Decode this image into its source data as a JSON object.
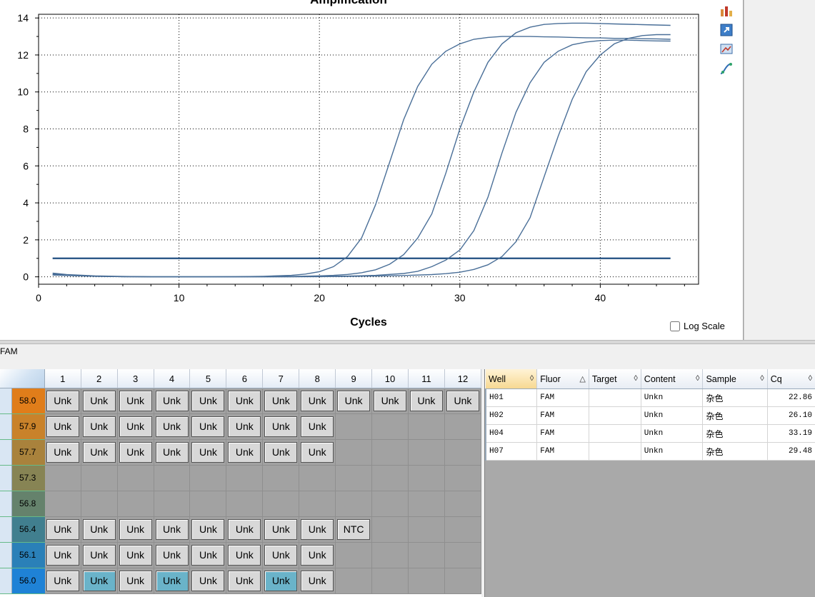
{
  "chart_data": {
    "type": "line",
    "title": "Amplification",
    "xlabel": "Cycles",
    "ylabel": "",
    "xlim": [
      0,
      47
    ],
    "ylim": [
      -0.4,
      14.2
    ],
    "xticks": [
      0,
      10,
      20,
      30,
      40
    ],
    "yticks": [
      0,
      2,
      4,
      6,
      8,
      10,
      12,
      14
    ],
    "grid": true,
    "threshold": 1.0,
    "series": [
      {
        "x": [
          1,
          2,
          4,
          6,
          8,
          10,
          12,
          14,
          16,
          18,
          19,
          20,
          21,
          22,
          23,
          24,
          25,
          26,
          27,
          28,
          29,
          30,
          31,
          32,
          33,
          34,
          35,
          36,
          37,
          38,
          39,
          40,
          41,
          42,
          43,
          44,
          45
        ],
        "y": [
          0.2,
          0.12,
          0.05,
          0.02,
          0.0,
          0.0,
          0.0,
          0.01,
          0.03,
          0.08,
          0.15,
          0.28,
          0.55,
          1.1,
          2.1,
          3.9,
          6.2,
          8.5,
          10.3,
          11.5,
          12.2,
          12.6,
          12.85,
          12.95,
          13.0,
          13.0,
          13.0,
          12.98,
          12.97,
          12.95,
          12.93,
          12.92,
          12.9,
          12.9,
          12.88,
          12.87,
          12.85
        ]
      },
      {
        "x": [
          1,
          2,
          4,
          6,
          8,
          10,
          12,
          14,
          16,
          18,
          20,
          21,
          22,
          23,
          24,
          25,
          26,
          27,
          28,
          29,
          30,
          31,
          32,
          33,
          34,
          35,
          36,
          37,
          38,
          39,
          40,
          41,
          42,
          43,
          44,
          45
        ],
        "y": [
          0.15,
          0.1,
          0.04,
          0.01,
          0.0,
          0.0,
          0.0,
          0.0,
          0.01,
          0.02,
          0.05,
          0.08,
          0.13,
          0.22,
          0.38,
          0.68,
          1.2,
          2.1,
          3.4,
          5.6,
          8.0,
          10.0,
          11.6,
          12.6,
          13.2,
          13.5,
          13.65,
          13.7,
          13.72,
          13.72,
          13.7,
          13.68,
          13.66,
          13.64,
          13.62,
          13.6
        ]
      },
      {
        "x": [
          1,
          2,
          4,
          6,
          8,
          10,
          12,
          14,
          16,
          18,
          20,
          22,
          24,
          26,
          27,
          28,
          29,
          30,
          31,
          32,
          33,
          34,
          35,
          36,
          37,
          38,
          39,
          40,
          41,
          42,
          43,
          44,
          45
        ],
        "y": [
          0.1,
          0.08,
          0.03,
          0.01,
          0.0,
          0.0,
          0.0,
          0.0,
          0.0,
          0.01,
          0.02,
          0.04,
          0.08,
          0.18,
          0.3,
          0.55,
          0.9,
          1.45,
          2.5,
          4.3,
          6.7,
          8.9,
          10.5,
          11.6,
          12.2,
          12.55,
          12.7,
          12.78,
          12.8,
          12.8,
          12.78,
          12.76,
          12.75
        ]
      },
      {
        "x": [
          1,
          2,
          4,
          6,
          8,
          10,
          12,
          14,
          16,
          18,
          20,
          22,
          24,
          26,
          28,
          29,
          30,
          31,
          32,
          33,
          34,
          35,
          36,
          37,
          38,
          39,
          40,
          41,
          42,
          43,
          44,
          45
        ],
        "y": [
          0.1,
          0.07,
          0.03,
          0.01,
          0.0,
          0.0,
          0.0,
          0.0,
          0.0,
          0.0,
          0.01,
          0.02,
          0.04,
          0.07,
          0.12,
          0.17,
          0.25,
          0.4,
          0.65,
          1.1,
          1.9,
          3.2,
          5.4,
          7.6,
          9.6,
          11.1,
          12.0,
          12.6,
          12.9,
          13.05,
          13.1,
          13.1
        ]
      }
    ]
  },
  "log_scale_label": "Log Scale",
  "fluor_tab": "FAM",
  "plate": {
    "columns": [
      "1",
      "2",
      "3",
      "4",
      "5",
      "6",
      "7",
      "8",
      "9",
      "10",
      "11",
      "12"
    ],
    "rows": [
      {
        "temp": "58.0",
        "color": "#e07d1a",
        "cells": [
          "Unk",
          "Unk",
          "Unk",
          "Unk",
          "Unk",
          "Unk",
          "Unk",
          "Unk",
          "Unk",
          "Unk",
          "Unk",
          "Unk"
        ]
      },
      {
        "temp": "57.9",
        "color": "#c9822a",
        "cells": [
          "Unk",
          "Unk",
          "Unk",
          "Unk",
          "Unk",
          "Unk",
          "Unk",
          "Unk",
          "",
          "",
          "",
          ""
        ]
      },
      {
        "temp": "57.7",
        "color": "#a9823c",
        "cells": [
          "Unk",
          "Unk",
          "Unk",
          "Unk",
          "Unk",
          "Unk",
          "Unk",
          "Unk",
          "",
          "",
          "",
          ""
        ]
      },
      {
        "temp": "57.3",
        "color": "#878454",
        "cells": [
          "",
          "",
          "",
          "",
          "",
          "",
          "",
          "",
          "",
          "",
          "",
          ""
        ]
      },
      {
        "temp": "56.8",
        "color": "#65826c",
        "cells": [
          "",
          "",
          "",
          "",
          "",
          "",
          "",
          "",
          "",
          "",
          "",
          ""
        ]
      },
      {
        "temp": "56.4",
        "color": "#417f8f",
        "cells": [
          "Unk",
          "Unk",
          "Unk",
          "Unk",
          "Unk",
          "Unk",
          "Unk",
          "Unk",
          "NTC",
          "",
          "",
          ""
        ]
      },
      {
        "temp": "56.1",
        "color": "#2a80b8",
        "cells": [
          "Unk",
          "Unk",
          "Unk",
          "Unk",
          "Unk",
          "Unk",
          "Unk",
          "Unk",
          "",
          "",
          "",
          ""
        ]
      },
      {
        "temp": "56.0",
        "color": "#1f82d6",
        "cells": [
          "Unk",
          "Unk",
          "Unk",
          "Unk",
          "Unk",
          "Unk",
          "Unk",
          "Unk",
          "",
          "",
          "",
          ""
        ],
        "selected": [
          1,
          3,
          6
        ]
      }
    ]
  },
  "results": {
    "headers": [
      {
        "label": "Well",
        "sort": "◊"
      },
      {
        "label": "Fluor",
        "sort": "△"
      },
      {
        "label": "Target",
        "sort": "◊"
      },
      {
        "label": "Content",
        "sort": "◊"
      },
      {
        "label": "Sample",
        "sort": "◊"
      },
      {
        "label": "Cq",
        "sort": "◊"
      }
    ],
    "rows": [
      [
        "H01",
        "FAM",
        "",
        "Unkn",
        "杂色",
        "22.86"
      ],
      [
        "H02",
        "FAM",
        "",
        "Unkn",
        "杂色",
        "26.10"
      ],
      [
        "H04",
        "FAM",
        "",
        "Unkn",
        "杂色",
        "33.19"
      ],
      [
        "H07",
        "FAM",
        "",
        "Unkn",
        "杂色",
        "29.48"
      ]
    ]
  },
  "toolbar": {
    "icons": [
      "chart-settings-icon",
      "export-icon",
      "image-copy-icon",
      "curve-icon"
    ]
  },
  "colors": {
    "curve": "#4a6f98",
    "threshold": "#1f4e80",
    "well_empty": "#a2a2a2",
    "well_selected": "#6ab3c9"
  }
}
